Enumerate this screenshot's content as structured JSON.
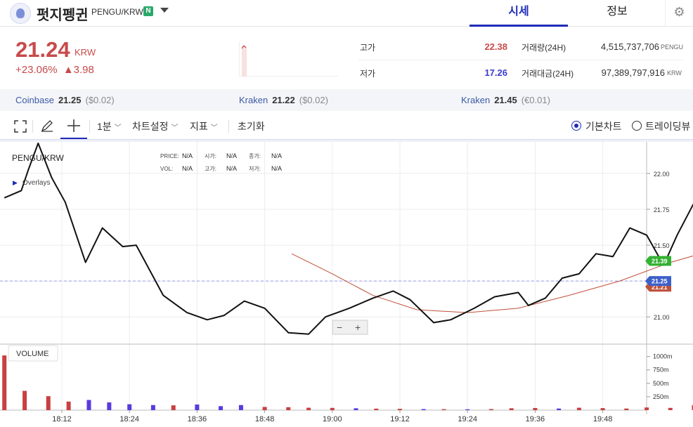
{
  "header": {
    "coin_name": "펏지펭귄",
    "pair": "PENGU/KRW",
    "badge": "N",
    "tabs": [
      "시세",
      "정보"
    ],
    "active_tab": "시세",
    "settings_icon": "gear-icon"
  },
  "price": {
    "current": "21.24",
    "unit": "KRW",
    "change_pct": "+23.06%",
    "change_abs": "▲3.98",
    "color": "#c84a4a"
  },
  "stats": {
    "high_label": "고가",
    "high_value": "22.38",
    "low_label": "저가",
    "low_value": "17.26",
    "volume_label": "거래량(24H)",
    "volume_value": "4,515,737,706",
    "volume_unit": "PENGU",
    "amount_label": "거래대금(24H)",
    "amount_value": "97,389,797,916",
    "amount_unit": "KRW"
  },
  "exchanges": [
    {
      "name": "Coinbase",
      "price": "21.25",
      "diff": "($0.02)"
    },
    {
      "name": "Kraken",
      "price": "21.22",
      "diff": "($0.02)"
    },
    {
      "name": "Kraken",
      "price": "21.45",
      "diff": "(€0.01)"
    }
  ],
  "toolbar": {
    "interval": "1분",
    "chart_settings": "차트설정",
    "indicators": "지표",
    "reset": "초기화",
    "basic_chart": "기본차트",
    "trading_view": "트레이딩뷰"
  },
  "chart_legend": {
    "symbol": "PENGU/KRW",
    "overlays": "Overlays",
    "price_label": "PRICE:",
    "price_val": "N/A",
    "open_label": "시가:",
    "open_val": "N/A",
    "close_label": "종가:",
    "close_val": "N/A",
    "vol_label": "VOL:",
    "vol_val": "N/A",
    "high_label": "고가:",
    "high_val": "N/A",
    "low_label": "저가:",
    "low_val": "N/A",
    "volume_title": "VOLUME",
    "zoom_out": "−",
    "zoom_in": "+"
  },
  "chart_data": {
    "type": "line",
    "x_labels": [
      "18:12",
      "18:24",
      "18:36",
      "18:48",
      "19:00",
      "19:12",
      "19:24",
      "19:36",
      "19:48"
    ],
    "y_ticks": [
      22.0,
      21.75,
      21.5,
      21.25,
      21.0
    ],
    "ylim": [
      20.81,
      22.22
    ],
    "volume_ticks": [
      "1000m",
      "750m",
      "500m",
      "250m"
    ],
    "volume_max": 1100,
    "markers": {
      "ma_green": "21.39",
      "current": "21.25",
      "ma_red": "21.21"
    },
    "price_line": "21.25",
    "colors": {
      "price": "#111111",
      "ma_red": "#c0503a",
      "ma_green": "#33b233",
      "vol_up": "#c84040",
      "vol_down": "#5a3ae0"
    },
    "price": [
      [
        18.03,
        21.83
      ],
      [
        18.08,
        21.88
      ],
      [
        18.1,
        22.02
      ],
      [
        18.13,
        22.21
      ],
      [
        18.17,
        21.97
      ],
      [
        18.21,
        21.8
      ],
      [
        18.27,
        21.38
      ],
      [
        18.32,
        21.62
      ],
      [
        18.38,
        21.49
      ],
      [
        18.42,
        21.5
      ],
      [
        18.5,
        21.15
      ],
      [
        18.57,
        21.03
      ],
      [
        18.63,
        20.98
      ],
      [
        18.68,
        21.01
      ],
      [
        18.74,
        21.11
      ],
      [
        18.8,
        21.06
      ],
      [
        18.87,
        20.89
      ],
      [
        18.93,
        20.88
      ],
      [
        18.98,
        21.0
      ],
      [
        19.05,
        21.06
      ],
      [
        19.12,
        21.13
      ],
      [
        19.18,
        21.18
      ],
      [
        19.23,
        21.12
      ],
      [
        19.3,
        20.96
      ],
      [
        19.35,
        20.98
      ],
      [
        19.42,
        21.06
      ],
      [
        19.48,
        21.14
      ],
      [
        19.55,
        21.17
      ],
      [
        19.58,
        21.08
      ],
      [
        19.63,
        21.13
      ],
      [
        19.68,
        21.27
      ],
      [
        19.73,
        21.3
      ],
      [
        19.78,
        21.44
      ],
      [
        19.83,
        21.42
      ],
      [
        19.88,
        21.62
      ],
      [
        19.93,
        21.57
      ],
      [
        19.98,
        21.36
      ],
      [
        20.02,
        21.57
      ],
      [
        20.08,
        21.84
      ],
      [
        20.13,
        21.57
      ],
      [
        20.18,
        21.52
      ],
      [
        20.22,
        21.62
      ],
      [
        20.28,
        21.64
      ],
      [
        20.32,
        21.65
      ],
      [
        20.38,
        21.53
      ],
      [
        20.43,
        21.72
      ],
      [
        20.48,
        21.66
      ],
      [
        20.55,
        21.62
      ],
      [
        20.6,
        21.5
      ],
      [
        20.65,
        21.29
      ],
      [
        20.72,
        21.32
      ],
      [
        20.77,
        21.25
      ],
      [
        20.85,
        21.29
      ],
      [
        20.9,
        21.25
      ],
      [
        20.95,
        21.18
      ],
      [
        21.02,
        21.22
      ],
      [
        21.1,
        21.25
      ],
      [
        21.17,
        21.28
      ],
      [
        21.22,
        21.34
      ],
      [
        21.27,
        21.28
      ],
      [
        21.3,
        21.26
      ],
      [
        21.35,
        21.21
      ],
      [
        21.38,
        21.26
      ],
      [
        21.43,
        21.29
      ],
      [
        21.48,
        21.3
      ],
      [
        21.55,
        21.44
      ],
      [
        21.6,
        21.38
      ],
      [
        21.65,
        21.36
      ],
      [
        21.7,
        21.35
      ],
      [
        21.75,
        21.42
      ],
      [
        21.8,
        21.41
      ],
      [
        21.88,
        21.47
      ],
      [
        21.93,
        21.43
      ],
      [
        21.98,
        21.48
      ],
      [
        22.02,
        21.51
      ],
      [
        22.08,
        21.57
      ],
      [
        22.12,
        21.53
      ],
      [
        22.18,
        21.44
      ],
      [
        22.23,
        21.4
      ],
      [
        22.28,
        21.43
      ],
      [
        22.35,
        21.47
      ],
      [
        22.4,
        21.56
      ],
      [
        22.45,
        21.53
      ],
      [
        22.48,
        21.61
      ],
      [
        22.53,
        21.55
      ],
      [
        22.58,
        21.58
      ],
      [
        22.63,
        21.54
      ],
      [
        22.7,
        21.6
      ],
      [
        22.77,
        21.59
      ],
      [
        22.82,
        21.47
      ],
      [
        22.85,
        21.43
      ],
      [
        22.9,
        21.49
      ],
      [
        22.95,
        21.51
      ],
      [
        23.02,
        21.46
      ],
      [
        23.08,
        21.42
      ],
      [
        23.13,
        21.4
      ],
      [
        23.18,
        21.35
      ],
      [
        23.22,
        21.34
      ],
      [
        23.28,
        21.14
      ],
      [
        23.32,
        21.18
      ],
      [
        23.38,
        21.18
      ],
      [
        23.45,
        21.21
      ],
      [
        23.52,
        21.19
      ],
      [
        23.58,
        21.18
      ],
      [
        23.65,
        21.25
      ],
      [
        23.72,
        21.24
      ],
      [
        23.78,
        21.25
      ],
      [
        23.82,
        21.16
      ],
      [
        23.88,
        21.25
      ],
      [
        23.92,
        21.25
      ]
    ],
    "ma_red": [
      [
        18.88,
        21.44
      ],
      [
        19.0,
        21.3
      ],
      [
        19.12,
        21.15
      ],
      [
        19.25,
        21.05
      ],
      [
        19.4,
        21.03
      ],
      [
        19.55,
        21.06
      ],
      [
        19.7,
        21.15
      ],
      [
        19.85,
        21.25
      ],
      [
        20.0,
        21.38
      ],
      [
        20.12,
        21.46
      ],
      [
        20.25,
        21.51
      ],
      [
        20.38,
        21.55
      ],
      [
        20.48,
        21.57
      ],
      [
        20.58,
        21.54
      ],
      [
        20.7,
        21.49
      ],
      [
        20.85,
        21.41
      ],
      [
        21.0,
        21.34
      ],
      [
        21.15,
        21.3
      ],
      [
        21.3,
        21.28
      ],
      [
        21.45,
        21.3
      ],
      [
        21.6,
        21.36
      ],
      [
        21.75,
        21.41
      ],
      [
        21.9,
        21.46
      ],
      [
        22.05,
        21.49
      ],
      [
        22.2,
        21.52
      ],
      [
        22.35,
        21.54
      ],
      [
        22.5,
        21.55
      ],
      [
        22.65,
        21.53
      ],
      [
        22.8,
        21.5
      ],
      [
        22.95,
        21.47
      ],
      [
        23.1,
        21.41
      ],
      [
        23.25,
        21.34
      ],
      [
        23.4,
        21.29
      ],
      [
        23.55,
        21.25
      ],
      [
        23.7,
        21.23
      ],
      [
        23.85,
        21.22
      ],
      [
        23.92,
        21.21
      ]
    ],
    "ma_green": [
      [
        20.75,
        21.37
      ],
      [
        20.85,
        21.34
      ],
      [
        20.98,
        21.31
      ],
      [
        21.1,
        21.29
      ],
      [
        21.25,
        21.29
      ],
      [
        21.4,
        21.3
      ],
      [
        21.55,
        21.32
      ],
      [
        21.7,
        21.35
      ],
      [
        21.85,
        21.38
      ],
      [
        22.0,
        21.41
      ],
      [
        22.15,
        21.43
      ],
      [
        22.3,
        21.44
      ],
      [
        22.45,
        21.45
      ],
      [
        22.6,
        21.45
      ],
      [
        22.75,
        21.44
      ],
      [
        22.9,
        21.43
      ],
      [
        23.05,
        21.42
      ],
      [
        23.2,
        21.41
      ],
      [
        23.35,
        21.4
      ],
      [
        23.5,
        21.4
      ],
      [
        23.65,
        21.4
      ],
      [
        23.8,
        21.39
      ],
      [
        23.92,
        21.39
      ]
    ],
    "volume": [
      [
        18.03,
        1020,
        "up"
      ],
      [
        18.09,
        360,
        "up"
      ],
      [
        18.16,
        260,
        "up"
      ],
      [
        18.22,
        160,
        "up"
      ],
      [
        18.28,
        190,
        "down"
      ],
      [
        18.34,
        145,
        "down"
      ],
      [
        18.4,
        110,
        "down"
      ],
      [
        18.47,
        95,
        "down"
      ],
      [
        18.53,
        90,
        "up"
      ],
      [
        18.6,
        105,
        "down"
      ],
      [
        18.67,
        75,
        "down"
      ],
      [
        18.73,
        95,
        "down"
      ],
      [
        18.8,
        60,
        "up"
      ],
      [
        18.87,
        55,
        "up"
      ],
      [
        18.93,
        45,
        "up"
      ],
      [
        19.0,
        42,
        "up"
      ],
      [
        19.07,
        35,
        "down"
      ],
      [
        19.13,
        28,
        "up"
      ],
      [
        19.2,
        24,
        "up"
      ],
      [
        19.27,
        20,
        "down"
      ],
      [
        19.33,
        18,
        "up"
      ],
      [
        19.4,
        16,
        "down"
      ],
      [
        19.47,
        20,
        "up"
      ],
      [
        19.53,
        35,
        "up"
      ],
      [
        19.6,
        40,
        "up"
      ],
      [
        19.67,
        30,
        "down"
      ],
      [
        19.73,
        45,
        "up"
      ],
      [
        19.8,
        38,
        "up"
      ],
      [
        19.87,
        30,
        "up"
      ],
      [
        19.93,
        50,
        "up"
      ],
      [
        20.0,
        42,
        "up"
      ],
      [
        20.07,
        95,
        "up"
      ],
      [
        20.13,
        60,
        "down"
      ],
      [
        20.2,
        40,
        "up"
      ],
      [
        20.27,
        28,
        "up"
      ],
      [
        20.33,
        30,
        "down"
      ],
      [
        20.4,
        38,
        "up"
      ],
      [
        20.47,
        22,
        "down"
      ],
      [
        20.53,
        20,
        "up"
      ],
      [
        20.6,
        45,
        "down"
      ],
      [
        20.67,
        35,
        "down"
      ],
      [
        20.73,
        20,
        "up"
      ],
      [
        20.8,
        15,
        "down"
      ],
      [
        20.87,
        18,
        "up"
      ],
      [
        20.93,
        12,
        "down"
      ],
      [
        21.0,
        10,
        "up"
      ],
      [
        21.07,
        22,
        "down"
      ],
      [
        21.13,
        14,
        "up"
      ],
      [
        21.2,
        10,
        "down"
      ],
      [
        21.27,
        12,
        "up"
      ],
      [
        21.33,
        16,
        "down"
      ],
      [
        21.4,
        28,
        "up"
      ],
      [
        21.47,
        20,
        "up"
      ],
      [
        21.53,
        18,
        "down"
      ],
      [
        21.6,
        24,
        "up"
      ],
      [
        21.67,
        16,
        "down"
      ],
      [
        21.73,
        20,
        "up"
      ],
      [
        21.8,
        10,
        "up"
      ],
      [
        21.87,
        8,
        "down"
      ],
      [
        21.93,
        12,
        "up"
      ],
      [
        22.0,
        18,
        "up"
      ],
      [
        22.07,
        60,
        "up"
      ],
      [
        22.13,
        14,
        "down"
      ],
      [
        22.2,
        10,
        "up"
      ],
      [
        22.27,
        12,
        "down"
      ],
      [
        22.33,
        16,
        "up"
      ],
      [
        22.4,
        35,
        "up"
      ],
      [
        22.47,
        28,
        "down"
      ],
      [
        22.53,
        20,
        "up"
      ],
      [
        22.6,
        14,
        "down"
      ],
      [
        22.67,
        22,
        "up"
      ],
      [
        22.73,
        18,
        "down"
      ],
      [
        22.8,
        14,
        "up"
      ],
      [
        22.87,
        30,
        "down"
      ],
      [
        22.93,
        25,
        "up"
      ],
      [
        23.0,
        18,
        "down"
      ],
      [
        23.07,
        14,
        "up"
      ],
      [
        23.13,
        60,
        "up"
      ],
      [
        23.2,
        40,
        "down"
      ],
      [
        23.27,
        24,
        "up"
      ],
      [
        23.33,
        30,
        "down"
      ],
      [
        23.4,
        12,
        "up"
      ],
      [
        23.47,
        16,
        "down"
      ],
      [
        23.53,
        20,
        "up"
      ],
      [
        23.6,
        14,
        "down"
      ],
      [
        23.67,
        10,
        "up"
      ],
      [
        23.73,
        18,
        "down"
      ],
      [
        23.8,
        22,
        "up"
      ],
      [
        23.87,
        12,
        "down"
      ],
      [
        23.93,
        8,
        "up"
      ]
    ]
  }
}
